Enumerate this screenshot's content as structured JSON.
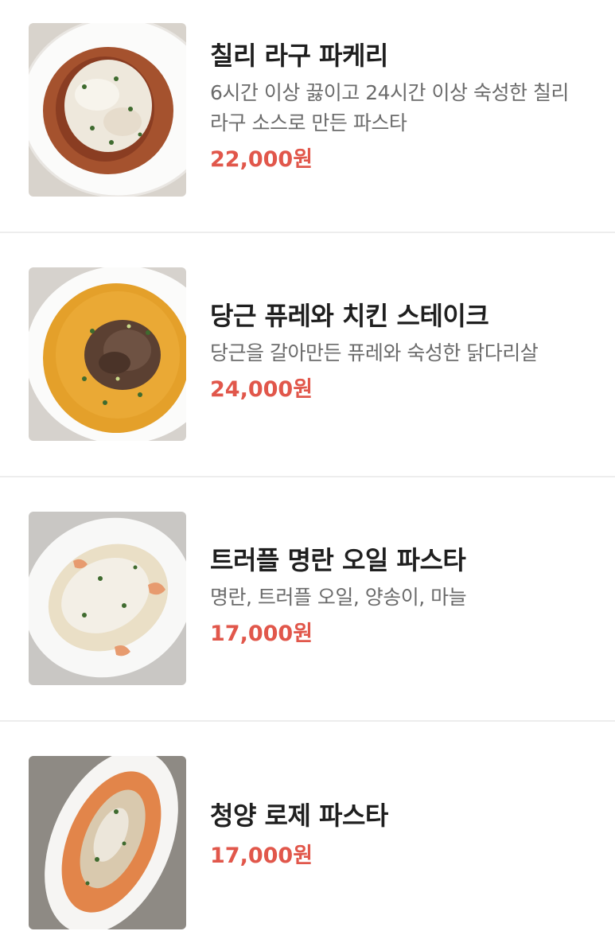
{
  "menu": {
    "items": [
      {
        "name": "칠리 라구 파케리",
        "description": "6시간 이상 끓이고 24시간 이상 숙성한 칠리 라구 소스로 만든 파스타",
        "price": "22,000원",
        "image": "chili-ragu-paccheri-photo"
      },
      {
        "name": "당근 퓨레와 치킨 스테이크",
        "description": "당근을 갈아만든 퓨레와 숙성한 닭다리살",
        "price": "24,000원",
        "image": "carrot-puree-chicken-steak-photo"
      },
      {
        "name": "트러플 명란 오일 파스타",
        "description": "명란, 트러플 오일, 양송이, 마늘",
        "price": "17,000원",
        "image": "truffle-mentaiko-oil-pasta-photo"
      },
      {
        "name": "청양 로제 파스타",
        "description": "",
        "price": "17,000원",
        "image": "cheongyang-rose-pasta-photo"
      }
    ]
  },
  "colors": {
    "price": "#e1574b",
    "name": "#1f1f1f",
    "description": "#6b6b6b",
    "divider": "#ededed"
  }
}
